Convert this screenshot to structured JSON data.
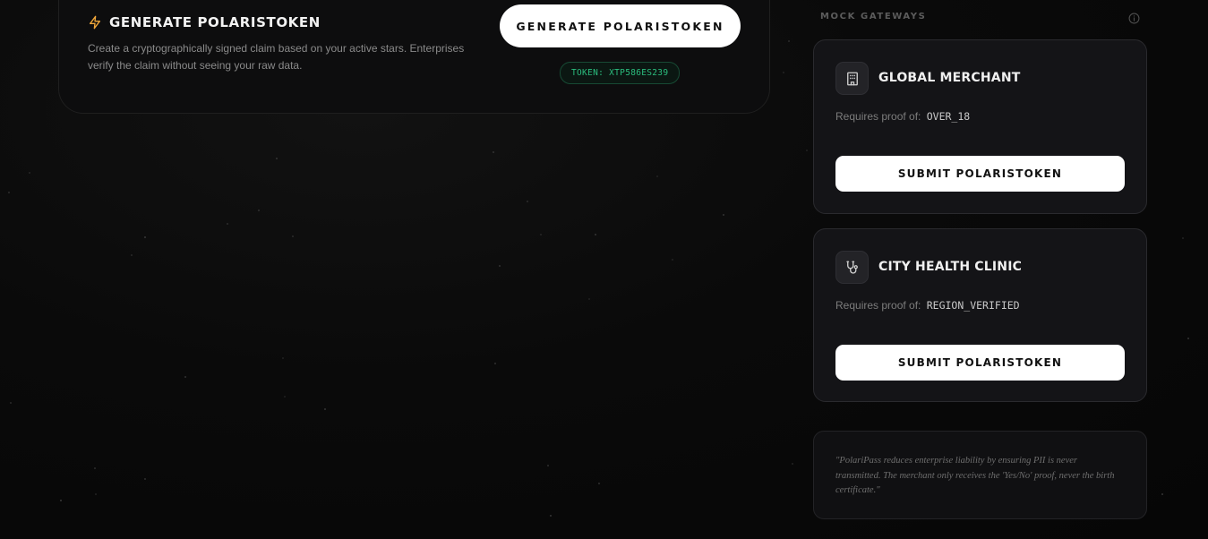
{
  "generate": {
    "title": "GENERATE POLARISTOKEN",
    "description": "Create a cryptographically signed claim based on your active stars. Enterprises verify the claim without seeing your raw data.",
    "button_label": "GENERATE POLARISTOKEN",
    "token_label": "TOKEN: XTP586ES239",
    "icon": "lightning-icon",
    "accent_color": "#f0a73a",
    "token_color": "#2bbd7e"
  },
  "gateways": {
    "heading": "MOCK GATEWAYS",
    "info_icon": "info-icon",
    "requires_prefix": "Requires proof of:",
    "items": [
      {
        "name": "GLOBAL MERCHANT",
        "icon": "building-icon",
        "requirement": "OVER_18",
        "button_label": "SUBMIT POLARISTOKEN"
      },
      {
        "name": "CITY HEALTH CLINIC",
        "icon": "stethoscope-icon",
        "requirement": "REGION_VERIFIED",
        "button_label": "SUBMIT POLARISTOKEN"
      }
    ]
  },
  "quote": {
    "text": "\"PolariPass reduces enterprise liability by ensuring PII is never transmitted. The merchant only receives the 'Yes/No' proof, never the birth certificate.\""
  }
}
